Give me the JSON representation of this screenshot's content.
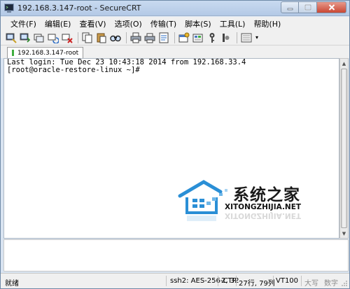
{
  "window": {
    "title": "192.168.3.147-root - SecureCRT"
  },
  "menu": {
    "items": [
      "文件(F)",
      "编辑(E)",
      "查看(V)",
      "选项(O)",
      "传输(T)",
      "脚本(S)",
      "工具(L)",
      "帮助(H)"
    ]
  },
  "toolbar": {
    "icons": [
      "connect-icon",
      "quick-connect-icon",
      "connect-tab-icon",
      "reconnect-icon",
      "disconnect-icon",
      "copy-icon",
      "paste-icon",
      "find-icon",
      "print-icon",
      "print-setup-icon",
      "log-session-icon",
      "session-options-icon",
      "global-options-icon",
      "keymap-icon",
      "sftp-icon",
      "help-icon",
      "options-icon"
    ]
  },
  "tab": {
    "label": "192.168.3.147-root"
  },
  "terminal": {
    "lines": [
      "Last login: Tue Dec 23 10:43:18 2014 from 192.168.33.4",
      "[root@oracle-restore-linux ~]#"
    ]
  },
  "watermark": {
    "cn": "系统之家",
    "en": "XITONGZHIJIA.NET"
  },
  "statusbar": {
    "ready": "就绪",
    "cipher": "ssh2: AES-256-CTR",
    "position": "2,  32",
    "size": "27行, 79列",
    "terminal_type": "VT100",
    "caps": "大写",
    "num": "数字"
  },
  "colors": {
    "titlebar": "#b3c9e6",
    "close_button": "#c94733",
    "tab_marker": "#3fae3f",
    "watermark_blue": "#2a8fd6"
  }
}
